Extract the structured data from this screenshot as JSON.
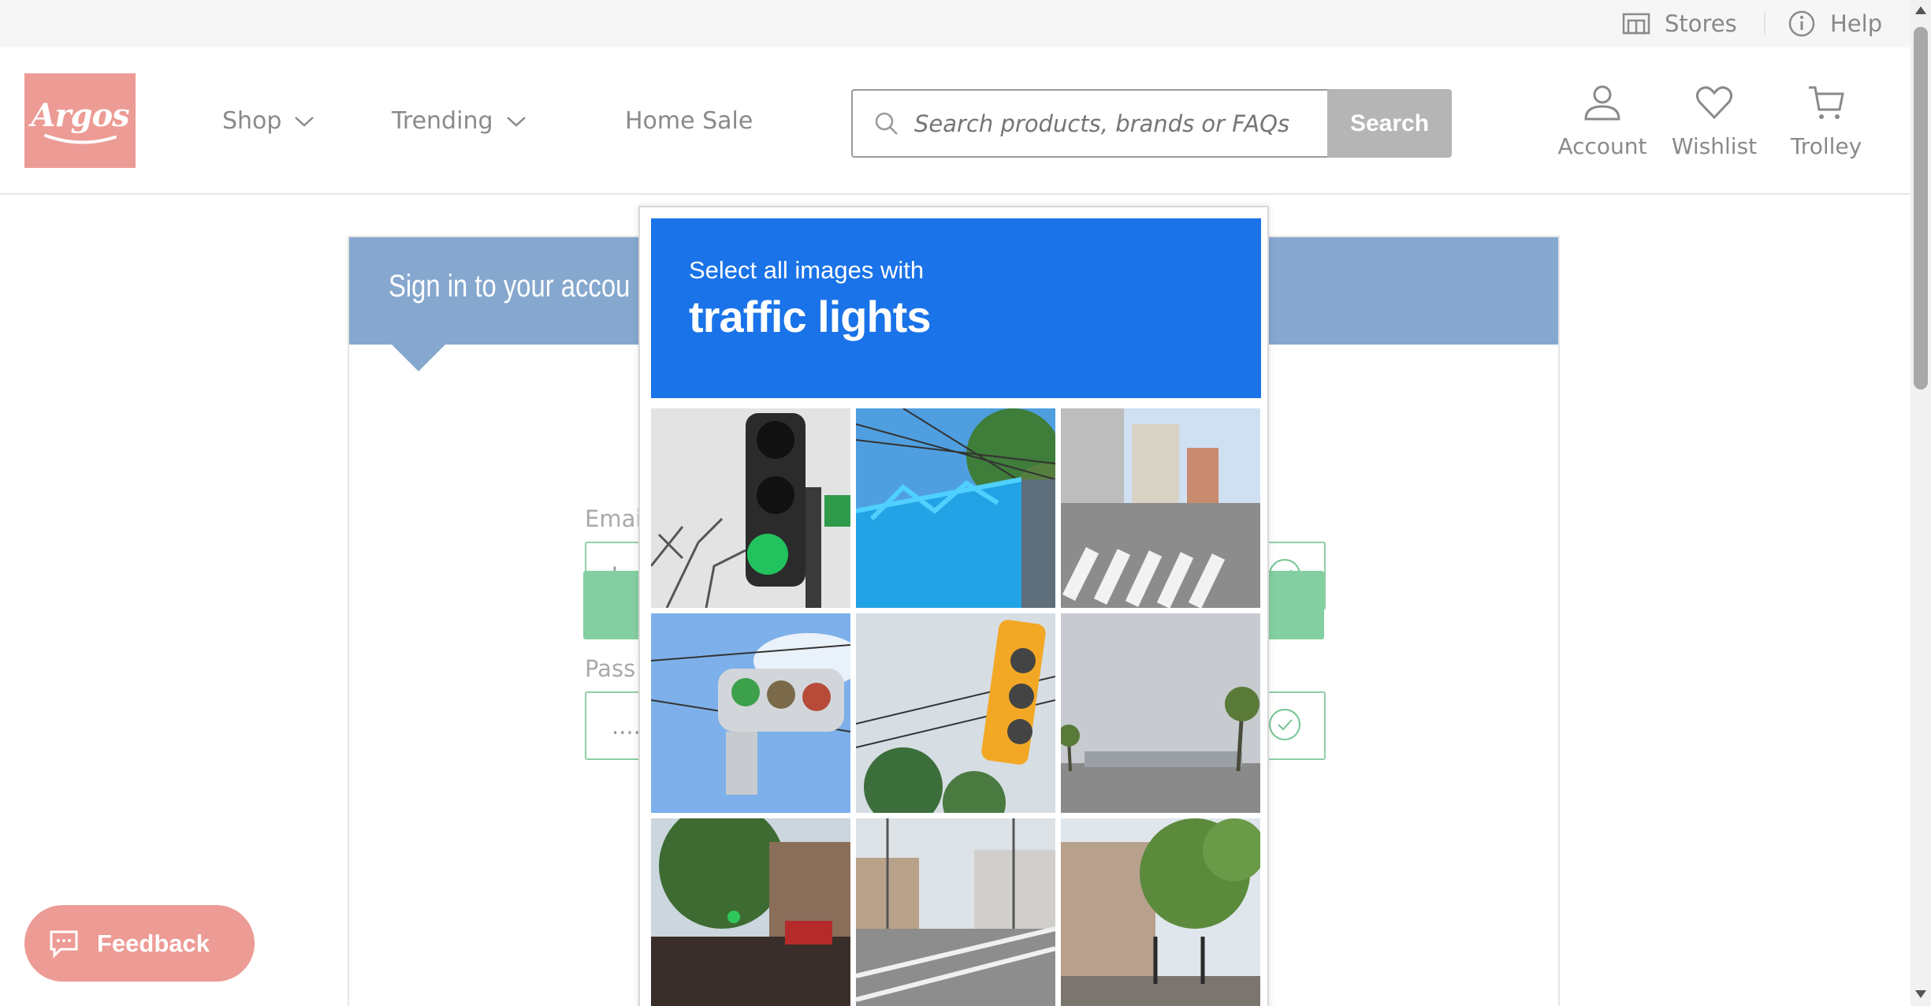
{
  "util_bar": {
    "stores_label": "Stores",
    "help_label": "Help"
  },
  "header": {
    "logo_text": "Argos",
    "nav": [
      "Shop",
      "Trending",
      "Home Sale"
    ],
    "search_placeholder": "Search products, brands or FAQs",
    "search_button": "Search",
    "account_label": "Account",
    "wishlist_label": "Wishlist",
    "trolley_label": "Trolley"
  },
  "signin": {
    "title": "Sign in to your accou",
    "email_label": "Emai",
    "email_value": "be",
    "password_label": "Pass",
    "password_value": "....."
  },
  "feedback_label": "Feedback",
  "captcha": {
    "instruction": "Select all images with",
    "target": "traffic lights",
    "tiles": [
      "traffic-light-green-tree",
      "blue-fence-power-lines",
      "street-crosswalk",
      "traffic-light-sky",
      "yellow-traffic-light",
      "road-palm-trees",
      "storefront-trees",
      "road-with-fence",
      "street-buildings-trees"
    ]
  },
  "colors": {
    "brand": "#ed9b95",
    "captcha_blue": "#1a73e8",
    "card_head": "#86a8cf",
    "success": "#84cfa2"
  }
}
